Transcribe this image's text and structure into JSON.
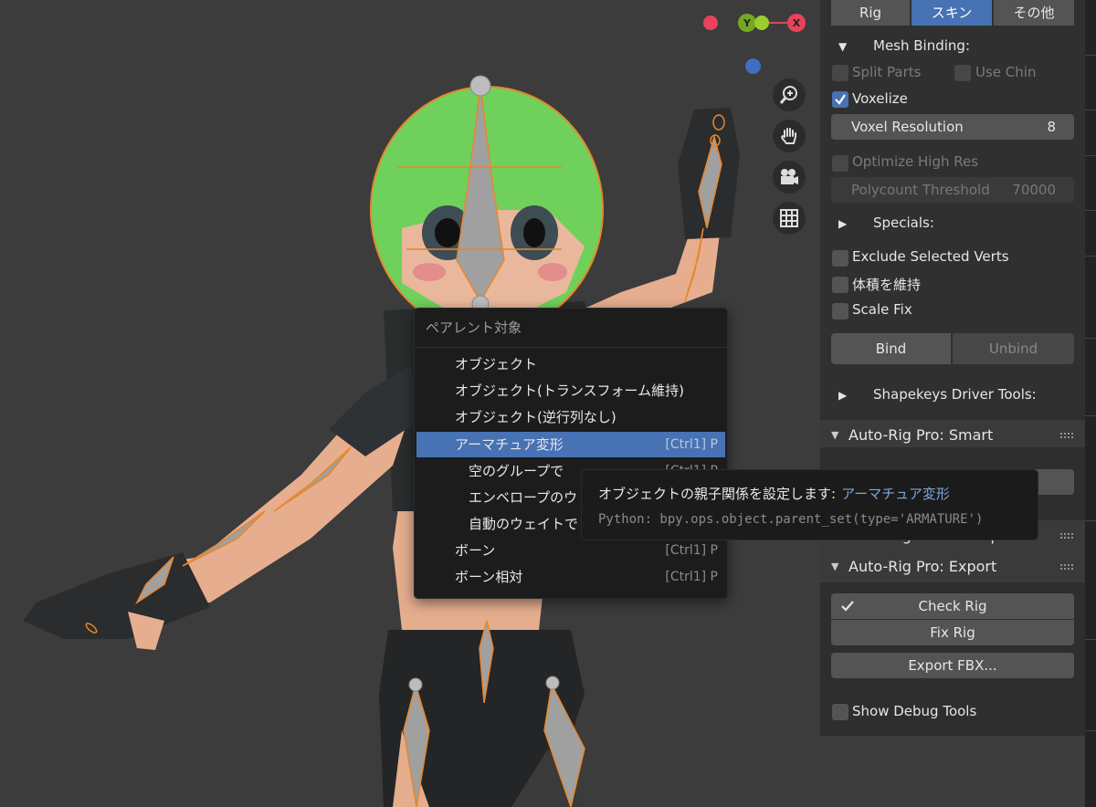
{
  "viewport": {
    "gizmo": {
      "y_label": "Y",
      "x_label": "X"
    }
  },
  "context_menu": {
    "title": "ペアレント対象",
    "items": [
      {
        "label": "オブジェクト",
        "shortcut": ""
      },
      {
        "label": "オブジェクト(トランスフォーム維持)",
        "shortcut": ""
      },
      {
        "label": "オブジェクト(逆行列なし)",
        "shortcut": ""
      },
      {
        "label": "アーマチュア変形",
        "shortcut": "[Ctrl1] P"
      },
      {
        "label": "空のグループで",
        "shortcut": "[Ctrl1] P"
      },
      {
        "label": "エンベロープのウ",
        "shortcut": ""
      },
      {
        "label": "自動のウェイトで",
        "shortcut": ""
      },
      {
        "label": "ボーン",
        "shortcut": "[Ctrl1] P"
      },
      {
        "label": "ボーン相対",
        "shortcut": "[Ctrl1] P"
      }
    ]
  },
  "tooltip": {
    "description": "オブジェクトの親子関係を設定します:",
    "highlight": "アーマチュア変形",
    "python": "Python: bpy.ops.object.parent_set(type='ARMATURE')"
  },
  "panel": {
    "tabs": [
      "Rig",
      "スキン",
      "その他"
    ],
    "mesh_binding": "Mesh Binding:",
    "split_parts": "Split Parts",
    "use_chin": "Use Chin",
    "voxelize": "Voxelize",
    "voxel_resolution": {
      "label": "Voxel Resolution",
      "value": "8"
    },
    "optimize_high_res": "Optimize High Res",
    "polycount_threshold": {
      "label": "Polycount Threshold",
      "value": "70000"
    },
    "specials": "Specials:",
    "exclude_selected_verts": "Exclude Selected Verts",
    "preserve_volume": "体積を維持",
    "scale_fix": "Scale Fix",
    "bind": "Bind",
    "unbind": "Unbind",
    "shapekeys": "Shapekeys Driver Tools:",
    "smart": "Auto-Rig Pro: Smart",
    "remap": "Auto-Rig Pro: Remap",
    "export": "Auto-Rig Pro: Export",
    "check_rig": "Check Rig",
    "fix_rig": "Fix Rig",
    "export_fbx": "Export FBX...",
    "show_debug": "Show Debug Tools"
  },
  "colors": {
    "accent": "#4772b3",
    "hair_green": "#6fd15c",
    "skin": "#e9b394",
    "outline_orange": "#e8862a"
  }
}
